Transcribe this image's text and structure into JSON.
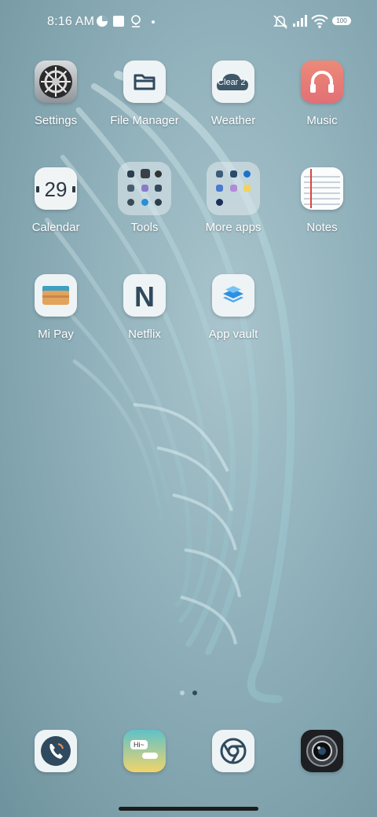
{
  "status_bar": {
    "time": "8:16 AM",
    "battery": "100",
    "icons": [
      "data-saver-icon",
      "notification-square-icon",
      "location-icon",
      "dot-icon",
      "mute-icon",
      "signal-icon",
      "wifi-icon",
      "battery-icon"
    ]
  },
  "apps": [
    {
      "label": "Settings",
      "icon": "gear-icon"
    },
    {
      "label": "File Manager",
      "icon": "folder-icon"
    },
    {
      "label": "Weather",
      "icon": "cloud-icon",
      "badge": "Clear 2°"
    },
    {
      "label": "Music",
      "icon": "headphones-icon"
    },
    {
      "label": "Calendar",
      "icon": "calendar-icon",
      "day": "29"
    },
    {
      "label": "Tools",
      "icon": "folder-tools-icon"
    },
    {
      "label": "More apps",
      "icon": "folder-more-apps-icon"
    },
    {
      "label": "Notes",
      "icon": "notes-icon"
    },
    {
      "label": "Mi Pay",
      "icon": "wallet-icon"
    },
    {
      "label": "Netflix",
      "icon": "netflix-icon",
      "glyph": "N"
    },
    {
      "label": "App vault",
      "icon": "layers-icon"
    }
  ],
  "dock": [
    {
      "name": "phone",
      "icon": "phone-icon"
    },
    {
      "name": "messages",
      "icon": "messages-icon",
      "bubble": "Hi~"
    },
    {
      "name": "chrome",
      "icon": "chrome-icon"
    },
    {
      "name": "camera",
      "icon": "camera-icon"
    }
  ],
  "page_indicator": {
    "pages": 2,
    "current": 2
  },
  "colors": {
    "label_text": "#ffffff",
    "music": "#ea7a70",
    "navy": "#2f4a5e"
  }
}
